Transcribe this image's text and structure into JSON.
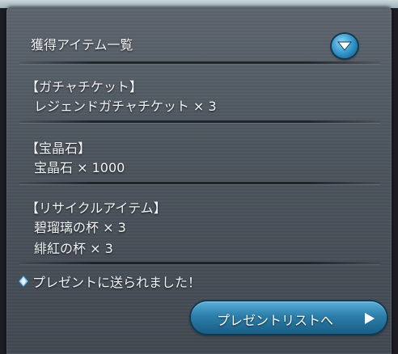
{
  "header": {
    "title": "獲得アイテム一覧",
    "toggle_icon": "chevron-down-icon",
    "accent_color": "#2c8fc6"
  },
  "sections": [
    {
      "heading": "【ガチャチケット】",
      "items": [
        {
          "label": "レジェンドガチャチケット × 3"
        }
      ]
    },
    {
      "heading": "【宝晶石】",
      "items": [
        {
          "label": "宝晶石 × 1000"
        }
      ]
    },
    {
      "heading": "【リサイクルアイテム】",
      "items": [
        {
          "label": "碧瑠璃の杯 × 3"
        },
        {
          "label": "緋紅の杯 × 3"
        }
      ]
    }
  ],
  "notice": {
    "icon": "diamond-icon",
    "text": "プレゼントに送られました！"
  },
  "present_button": {
    "label": "プレゼントリストへ",
    "icon": "play-arrow-icon"
  }
}
